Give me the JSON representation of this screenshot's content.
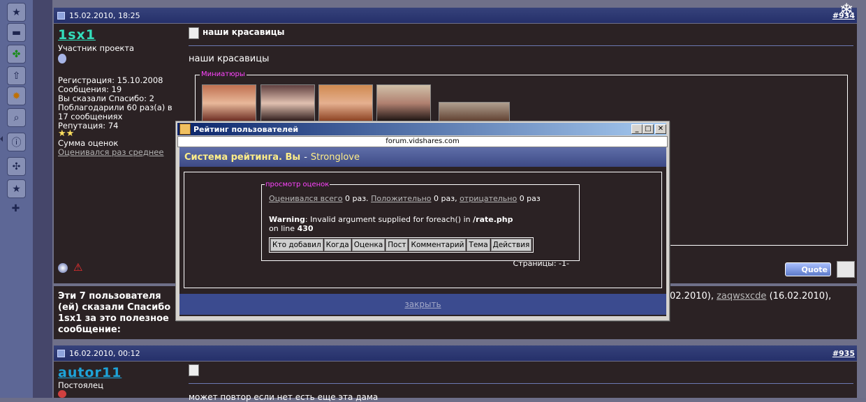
{
  "sidebar": {
    "icons": [
      "star-icon",
      "folder-icon",
      "clover-icon",
      "upload-icon",
      "gear-icon",
      "search-icon",
      "info-icon",
      "fan-icon",
      "star-icon-2",
      "plus-icon"
    ]
  },
  "post1": {
    "date": "15.02.2010, 18:25",
    "number": "#934",
    "username": "1sx1",
    "rank": "Участник проекта",
    "reg": "Регистрация: 15.10.2008",
    "messages": "Сообщения: 19",
    "said_thanks": "Вы сказали Спасибо: 2",
    "thanked_1": "Поблагодарили 60 раз(а) в",
    "thanked_2": "17 сообщениях",
    "reputation": "Репутация: 74",
    "ratings_sum": "Сумма оценок",
    "rated_link": "Оценивался раз среднее",
    "title": "наши красавицы",
    "text": "наши красавицы",
    "thumbs_legend": "Миниатюры",
    "quote_label": "Quote"
  },
  "thanks": {
    "text_1": "Эти 7 пользователя",
    "text_2": "(ей) сказали Спасибо",
    "text_3": "1sx1 за это полезное",
    "text_4": "сообщение:",
    "tail_1": "02.2010),",
    "tail_user": "zaqwsxcde",
    "tail_2": "(16.02.2010),"
  },
  "post2": {
    "date": "16.02.2010, 00:12",
    "number": "#935",
    "username": "autor11",
    "rank": "Постоялец",
    "text": "может повтор если нет есть еще эта дама"
  },
  "popup": {
    "window_title": "Рейтинг пользователей",
    "url": "forum.vidshares.com",
    "heading": "Система рейтинга. Вы",
    "heading_sep": "-",
    "heading_user": "Stronglove",
    "legend": "просмотр оценок",
    "rated_all": "Оценивался всего",
    "rated_all_val": "0 раз.",
    "positive": "Положительно",
    "positive_val": "0 раз,",
    "negative": "отрицательно",
    "negative_val": "0 раз",
    "warning_label": "Warning",
    "warning_text": ": Invalid argument supplied for foreach() in",
    "warning_file": "/rate.php",
    "line_text": "on line",
    "line_num": "430",
    "columns": [
      "Кто добавил",
      "Когда",
      "Оценка",
      "Пост",
      "Комментарий",
      "Тема",
      "Действия"
    ],
    "pages": "Страницы: -1-",
    "close": "закрыть"
  }
}
